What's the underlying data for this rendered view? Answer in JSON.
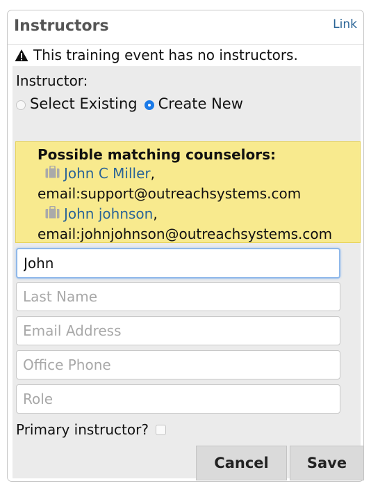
{
  "panel": {
    "title": "Instructors",
    "link_label": "Link"
  },
  "warning": {
    "icon": "warning-triangle-icon",
    "text": "This training event has no instructors."
  },
  "instructor": {
    "label": "Instructor:",
    "options": [
      {
        "label": "Select Existing",
        "checked": false
      },
      {
        "label": "Create New",
        "checked": true
      }
    ]
  },
  "matches": {
    "title": "Possible matching counselors:",
    "items": [
      {
        "icon": "briefcase-icon",
        "name": "John C Miller",
        "suffix": ",",
        "email": "email:support@outreachsystems.com"
      },
      {
        "icon": "briefcase-icon",
        "name": "John johnson",
        "suffix": ",",
        "email": "email:johnjohnson@outreachsystems.com"
      }
    ]
  },
  "form": {
    "first_name_value": "John",
    "last_name_placeholder": "Last Name",
    "email_placeholder": "Email Address",
    "phone_placeholder": "Office Phone",
    "role_placeholder": "Role",
    "primary_label": "Primary instructor?",
    "primary_checked": false
  },
  "buttons": {
    "cancel": "Cancel",
    "save": "Save"
  },
  "colors": {
    "link": "#2a6496",
    "highlight": "#f8ea8e",
    "radio_selected": "#1a7ae8"
  }
}
